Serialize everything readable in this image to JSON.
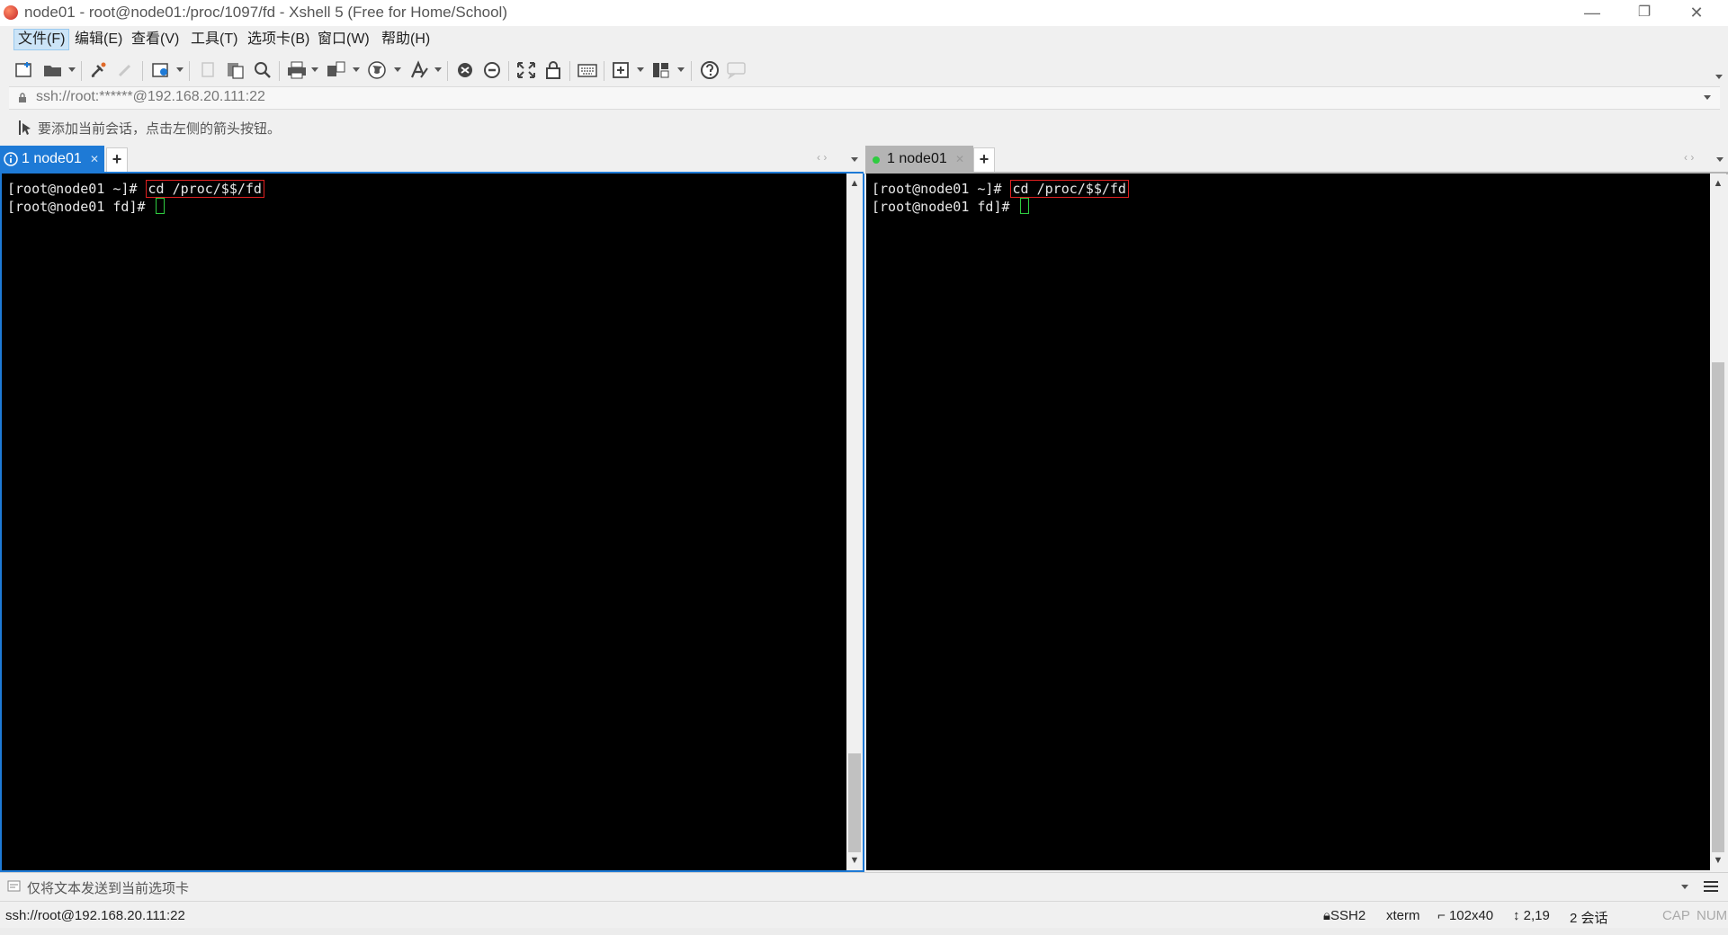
{
  "window": {
    "title": "node01 - root@node01:/proc/1097/fd - Xshell 5 (Free for Home/School)",
    "minimize": "—",
    "restore": "❐",
    "close": "✕"
  },
  "menu": [
    {
      "label": "文件(F)",
      "active": true
    },
    {
      "label": "编辑(E)"
    },
    {
      "label": "查看(V)"
    },
    {
      "label": "工具(T)"
    },
    {
      "label": "选项卡(B)"
    },
    {
      "label": "窗口(W)"
    },
    {
      "label": "帮助(H)"
    }
  ],
  "address": {
    "value": "ssh://root:******@192.168.20.111:22"
  },
  "hint": {
    "text": "要添加当前会话，点击左侧的箭头按钮。"
  },
  "left_pane": {
    "tab_label": "1 node01",
    "tab_status": "info",
    "lines": [
      {
        "prompt": "[root@node01 ~]# ",
        "command": "cd /proc/$$/fd"
      },
      {
        "prompt": "[root@node01 fd]# ",
        "command": ""
      }
    ]
  },
  "right_pane": {
    "tab_label": "1 node01",
    "tab_status": "connected",
    "lines": [
      {
        "prompt": "[root@node01 ~]# ",
        "command": "cd /proc/$$/fd"
      },
      {
        "prompt": "[root@node01 fd]# ",
        "command": ""
      }
    ]
  },
  "compose": {
    "text": "仅将文本发送到当前选项卡"
  },
  "status": {
    "connection": "ssh://root@192.168.20.111:22",
    "protocol": "SSH2",
    "terminal": "xterm",
    "size": "102x40",
    "cursor": "2,19",
    "sessions": "2 会话",
    "cap": "CAP",
    "num": "NUM"
  },
  "colors": {
    "accent": "#1e7ad6",
    "highlight_box": "#e02020",
    "cursor": "#2ecc40",
    "connected_dot": "#2ecc40"
  }
}
